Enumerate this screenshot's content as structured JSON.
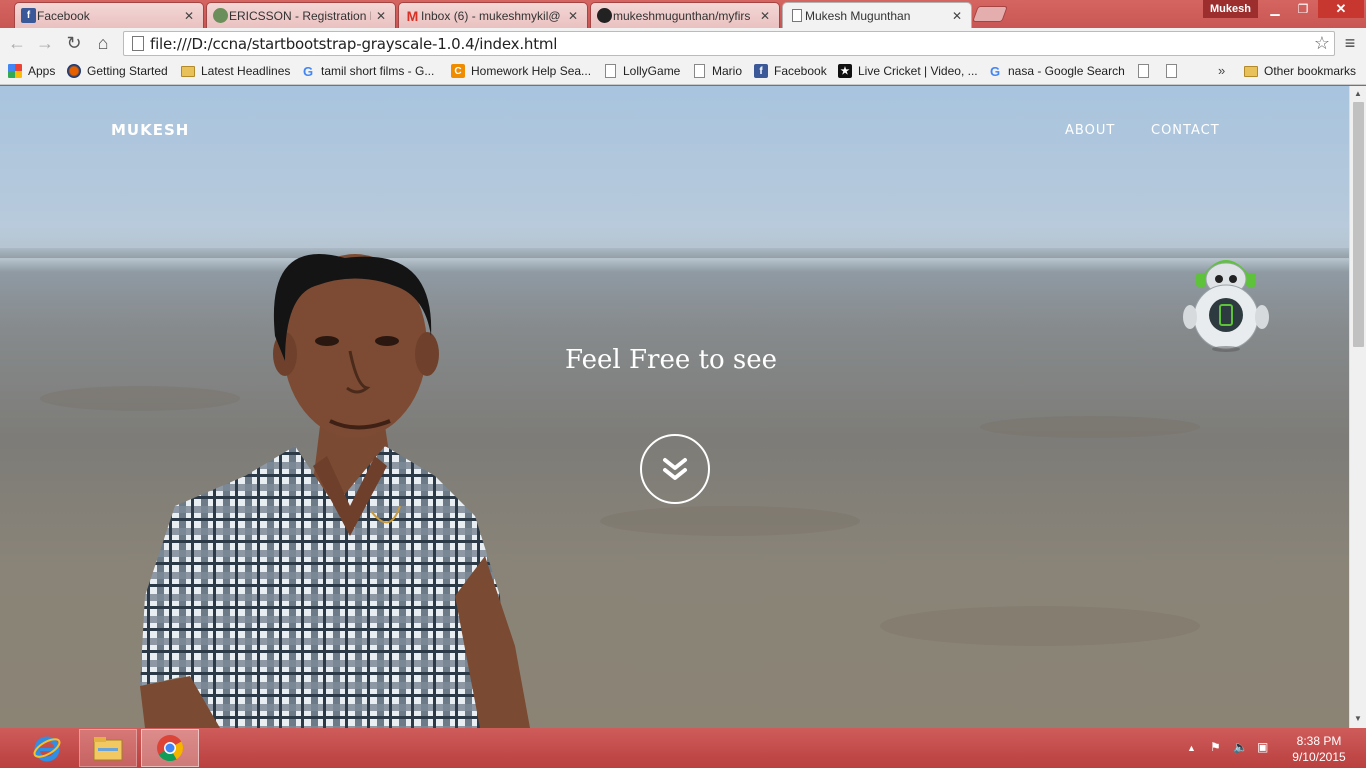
{
  "browser": {
    "tabs": [
      {
        "title": "Facebook",
        "icon": "facebook-icon"
      },
      {
        "title": "ERICSSON - Registration F",
        "icon": "globe-icon"
      },
      {
        "title": "Inbox (6) - mukeshmykil@",
        "icon": "gmail-icon"
      },
      {
        "title": "mukeshmugunthan/myfirs",
        "icon": "github-icon"
      },
      {
        "title": "Mukesh Mugunthan",
        "icon": "page-icon"
      }
    ],
    "profile_name": "Mukesh",
    "url": "file:///D:/ccna/startbootstrap-grayscale-1.0.4/index.html",
    "bookmarks": [
      {
        "label": "Apps",
        "icon": "apps-grid-icon"
      },
      {
        "label": "Getting Started",
        "icon": "firefox-icon"
      },
      {
        "label": "Latest Headlines",
        "icon": "folder-icon"
      },
      {
        "label": "tamil short films - G...",
        "icon": "google-icon"
      },
      {
        "label": "Homework Help Sea...",
        "icon": "chegg-icon"
      },
      {
        "label": "LollyGame",
        "icon": "page-icon"
      },
      {
        "label": "Mario",
        "icon": "page-icon"
      },
      {
        "label": "Facebook",
        "icon": "facebook-icon"
      },
      {
        "label": "Live Cricket | Video, ...",
        "icon": "cricket-icon"
      },
      {
        "label": "nasa - Google Search",
        "icon": "google-icon"
      }
    ],
    "bookmarks_overflow": "»",
    "other_bookmarks": "Other bookmarks"
  },
  "page": {
    "brand": "MUKESH",
    "nav": [
      "ABOUT",
      "CONTACT"
    ],
    "heading": "Feel Free to see"
  },
  "taskbar": {
    "time": "8:38 PM",
    "date": "9/10/2015",
    "apps": [
      "internet-explorer-icon",
      "file-explorer-icon",
      "chrome-icon"
    ]
  },
  "colors": {
    "titlebar": "#c95654",
    "accent_robot": "#5ec23a",
    "taskbar": "#c04a48"
  }
}
